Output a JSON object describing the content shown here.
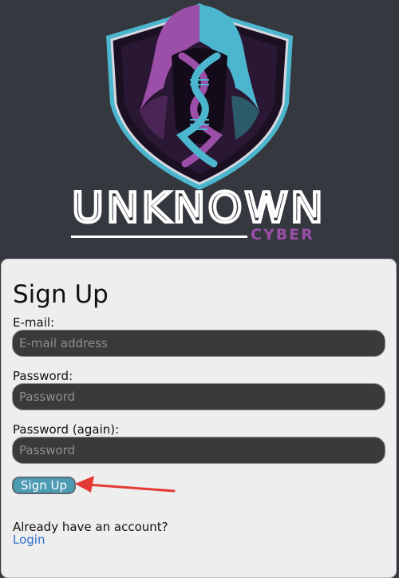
{
  "brand": {
    "name": "UNKNOWN",
    "subtitle": "CYBER",
    "icon": "hooded-figure-dna-shield-logo"
  },
  "form": {
    "title": "Sign Up",
    "email_label": "E-mail:",
    "email_placeholder": "E-mail address",
    "email_value": "",
    "password_label": "Password:",
    "password_placeholder": "Password",
    "password_value": "",
    "password2_label": "Password (again):",
    "password2_placeholder": "Password",
    "password2_value": "",
    "submit_label": "Sign Up"
  },
  "footer": {
    "prompt": "Already have an account?",
    "login_label": "Login"
  },
  "annotation": {
    "icon": "red-arrow-icon",
    "color": "#e53935"
  },
  "colors": {
    "background": "#35383f",
    "card": "#eeeeee",
    "input": "#3a3a3a",
    "button": "#4b9bb3",
    "link": "#2f6fd1",
    "brand_purple": "#9b4fa8",
    "brand_cyan": "#4db6cf"
  }
}
